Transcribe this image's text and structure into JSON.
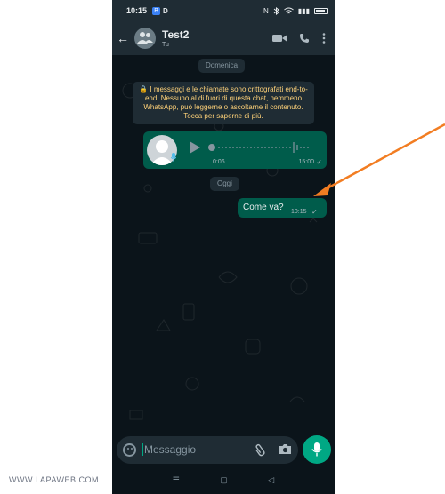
{
  "status_bar": {
    "time": "10:15",
    "bt_badge": "B",
    "d_badge": "D",
    "nfc": "N",
    "signal": "▮▮▮"
  },
  "header": {
    "title": "Test2",
    "subtitle": "Tu"
  },
  "chat": {
    "date_1": "Domenica",
    "system_message": "🔒 I messaggi e le chiamate sono crittografati end-to-end. Nessuno al di fuori di questa chat, nemmeno WhatsApp, può leggerne o ascoltarne il contenuto. Tocca per saperne di più.",
    "voice_note": {
      "duration": "0:06",
      "time": "15:00",
      "tick": "✓"
    },
    "date_2": "Oggi",
    "text_message": {
      "text": "Come va?",
      "time": "10:15",
      "tick": "✓"
    }
  },
  "composer": {
    "placeholder": "Messaggio"
  },
  "navbar": {
    "menu": "☰",
    "home": "▢",
    "back": "◁"
  },
  "watermark": "WWW.LAPAWEB.COM",
  "colors": {
    "bg": "#0b141a",
    "bar": "#1f2c34",
    "bubble_out": "#005c4b",
    "accent": "#00a884",
    "arrow": "#f27d22"
  }
}
